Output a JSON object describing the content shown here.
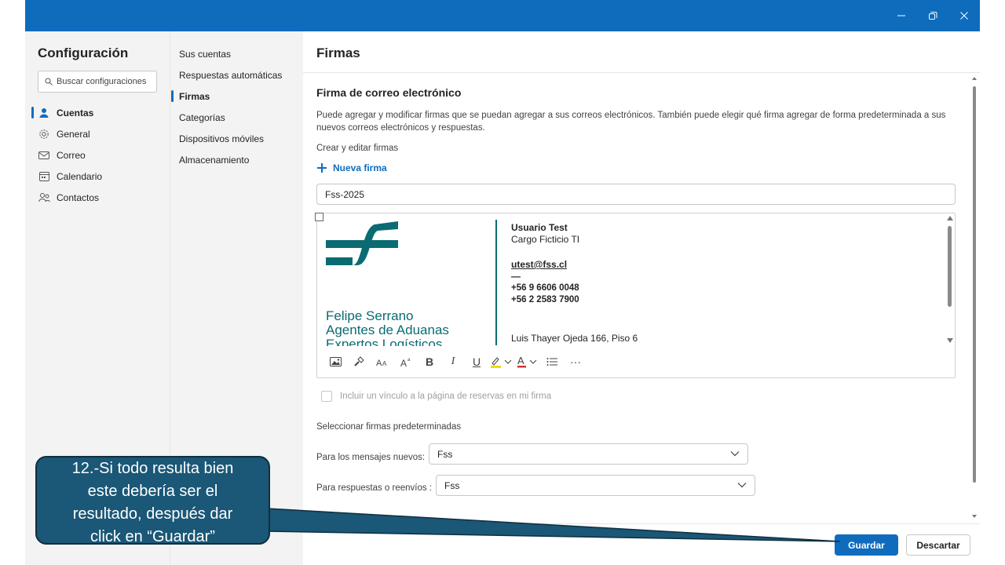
{
  "window": {
    "minimize_label": "–",
    "restore_label": "❐",
    "close_label": "✕"
  },
  "left": {
    "title": "Configuración",
    "search_placeholder": "Buscar configuraciones",
    "items": [
      {
        "label": "Cuentas",
        "icon": "person-icon"
      },
      {
        "label": "General",
        "icon": "gear-icon"
      },
      {
        "label": "Correo",
        "icon": "mail-icon"
      },
      {
        "label": "Calendario",
        "icon": "calendar-icon"
      },
      {
        "label": "Contactos",
        "icon": "people-icon"
      }
    ]
  },
  "sub": {
    "items": [
      "Sus cuentas",
      "Respuestas automáticas",
      "Firmas",
      "Categorías",
      "Dispositivos móviles",
      "Almacenamiento"
    ]
  },
  "main": {
    "title": "Firmas",
    "section_title": "Firma de correo electrónico",
    "description": "Puede agregar y modificar firmas que se puedan agregar a sus correos electrónicos. También puede elegir qué firma agregar de forma predeterminada a sus nuevos correos electrónicos y respuestas.",
    "create_label": "Crear y editar firmas",
    "new_signature": "Nueva firma",
    "signature_name": "Fss-2025",
    "signature": {
      "brand_line1": "Felipe Serrano",
      "brand_line2": "Agentes de Aduanas",
      "brand_line3": "Expertos Logísticos",
      "name": "Usuario Test",
      "role": "Cargo Ficticio TI",
      "email": "utest@fss.cl",
      "dash": "—",
      "phone1": "+56 9 6606 0048",
      "phone2": "+56 2 2583 7900",
      "address": "Luis Thayer Ojeda 166, Piso 6",
      "brand_color": "#0b6b72"
    },
    "toolbar": {
      "bold": "B",
      "italic": "I",
      "underline": "U",
      "font_color": "A",
      "more": "···"
    },
    "include_booking": "Incluir un vínculo a la página de reservas en mi firma",
    "defaults_label": "Seleccionar firmas predeterminadas",
    "new_messages_label": "Para los mensajes nuevos:",
    "new_messages_value": "Fss",
    "replies_label": "Para respuestas o reenvíos :",
    "replies_value": "Fss",
    "save": "Guardar",
    "discard": "Descartar",
    "accent": "#0f6cbd"
  },
  "callout": {
    "lines": [
      "12.-Si todo resulta bien",
      "este debería ser el",
      "resultado, después dar",
      "click en “Guardar”"
    ]
  }
}
